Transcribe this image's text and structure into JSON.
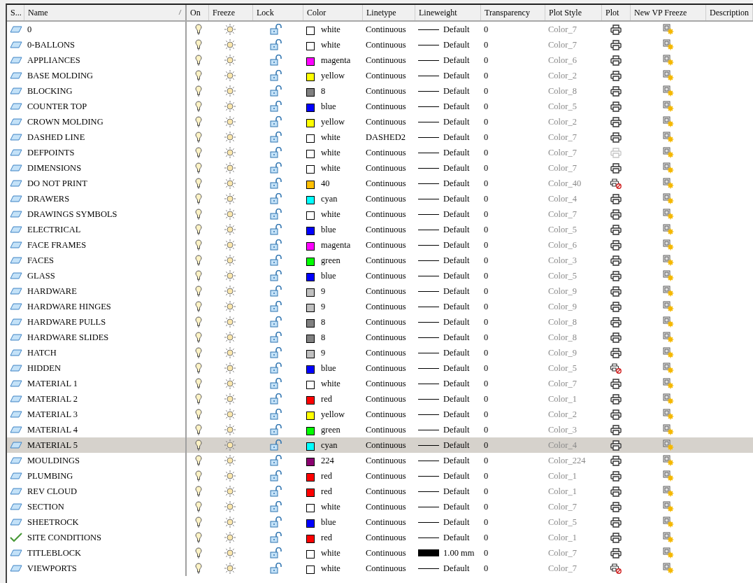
{
  "columns": [
    {
      "label": "S..."
    },
    {
      "label": "Name",
      "sorted": true
    },
    {
      "label": "On"
    },
    {
      "label": "Freeze"
    },
    {
      "label": "Lock"
    },
    {
      "label": "Color"
    },
    {
      "label": "Linetype"
    },
    {
      "label": "Lineweight"
    },
    {
      "label": "Transparency"
    },
    {
      "label": "Plot Style"
    },
    {
      "label": "Plot"
    },
    {
      "label": "New VP Freeze"
    },
    {
      "label": "Description"
    }
  ],
  "rows": [
    {
      "current": false,
      "name": "0",
      "on": true,
      "frozen": false,
      "locked": false,
      "color": "#ffffff",
      "color_name": "white",
      "linetype": "Continuous",
      "thick_line": false,
      "lineweight": "Default",
      "transparency": "0",
      "plot_style": "Color_7",
      "plot": true,
      "plot_dimmed": false,
      "selected": false
    },
    {
      "current": false,
      "name": "0-BALLONS",
      "on": true,
      "frozen": false,
      "locked": false,
      "color": "#ffffff",
      "color_name": "white",
      "linetype": "Continuous",
      "thick_line": false,
      "lineweight": "Default",
      "transparency": "0",
      "plot_style": "Color_7",
      "plot": true,
      "plot_dimmed": false,
      "selected": false
    },
    {
      "current": false,
      "name": "APPLIANCES",
      "on": true,
      "frozen": false,
      "locked": false,
      "color": "#ff00ff",
      "color_name": "magenta",
      "linetype": "Continuous",
      "thick_line": false,
      "lineweight": "Default",
      "transparency": "0",
      "plot_style": "Color_6",
      "plot": true,
      "plot_dimmed": false,
      "selected": false
    },
    {
      "current": false,
      "name": "BASE MOLDING",
      "on": true,
      "frozen": false,
      "locked": false,
      "color": "#ffff00",
      "color_name": "yellow",
      "linetype": "Continuous",
      "thick_line": false,
      "lineweight": "Default",
      "transparency": "0",
      "plot_style": "Color_2",
      "plot": true,
      "plot_dimmed": false,
      "selected": false
    },
    {
      "current": false,
      "name": "BLOCKING",
      "on": true,
      "frozen": false,
      "locked": false,
      "color": "#808080",
      "color_name": "8",
      "linetype": "Continuous",
      "thick_line": false,
      "lineweight": "Default",
      "transparency": "0",
      "plot_style": "Color_8",
      "plot": true,
      "plot_dimmed": false,
      "selected": false
    },
    {
      "current": false,
      "name": "COUNTER TOP",
      "on": true,
      "frozen": false,
      "locked": false,
      "color": "#0000ff",
      "color_name": "blue",
      "linetype": "Continuous",
      "thick_line": false,
      "lineweight": "Default",
      "transparency": "0",
      "plot_style": "Color_5",
      "plot": true,
      "plot_dimmed": false,
      "selected": false
    },
    {
      "current": false,
      "name": "CROWN MOLDING",
      "on": true,
      "frozen": false,
      "locked": false,
      "color": "#ffff00",
      "color_name": "yellow",
      "linetype": "Continuous",
      "thick_line": false,
      "lineweight": "Default",
      "transparency": "0",
      "plot_style": "Color_2",
      "plot": true,
      "plot_dimmed": false,
      "selected": false
    },
    {
      "current": false,
      "name": "DASHED LINE",
      "on": true,
      "frozen": false,
      "locked": false,
      "color": "#ffffff",
      "color_name": "white",
      "linetype": "DASHED2",
      "thick_line": false,
      "lineweight": "Default",
      "transparency": "0",
      "plot_style": "Color_7",
      "plot": true,
      "plot_dimmed": false,
      "selected": false
    },
    {
      "current": false,
      "name": "DEFPOINTS",
      "on": true,
      "frozen": false,
      "locked": false,
      "color": "#ffffff",
      "color_name": "white",
      "linetype": "Continuous",
      "thick_line": false,
      "lineweight": "Default",
      "transparency": "0",
      "plot_style": "Color_7",
      "plot": true,
      "plot_dimmed": true,
      "selected": false
    },
    {
      "current": false,
      "name": "DIMENSIONS",
      "on": true,
      "frozen": false,
      "locked": false,
      "color": "#ffffff",
      "color_name": "white",
      "linetype": "Continuous",
      "thick_line": false,
      "lineweight": "Default",
      "transparency": "0",
      "plot_style": "Color_7",
      "plot": true,
      "plot_dimmed": false,
      "selected": false
    },
    {
      "current": false,
      "name": "DO NOT PRINT",
      "on": true,
      "frozen": false,
      "locked": false,
      "color": "#ffbf00",
      "color_name": "40",
      "linetype": "Continuous",
      "thick_line": false,
      "lineweight": "Default",
      "transparency": "0",
      "plot_style": "Color_40",
      "plot": false,
      "plot_dimmed": false,
      "selected": false
    },
    {
      "current": false,
      "name": "DRAWERS",
      "on": true,
      "frozen": false,
      "locked": false,
      "color": "#00ffff",
      "color_name": "cyan",
      "linetype": "Continuous",
      "thick_line": false,
      "lineweight": "Default",
      "transparency": "0",
      "plot_style": "Color_4",
      "plot": true,
      "plot_dimmed": false,
      "selected": false
    },
    {
      "current": false,
      "name": "DRAWINGS SYMBOLS",
      "on": true,
      "frozen": false,
      "locked": false,
      "color": "#ffffff",
      "color_name": "white",
      "linetype": "Continuous",
      "thick_line": false,
      "lineweight": "Default",
      "transparency": "0",
      "plot_style": "Color_7",
      "plot": true,
      "plot_dimmed": false,
      "selected": false
    },
    {
      "current": false,
      "name": "ELECTRICAL",
      "on": true,
      "frozen": false,
      "locked": false,
      "color": "#0000ff",
      "color_name": "blue",
      "linetype": "Continuous",
      "thick_line": false,
      "lineweight": "Default",
      "transparency": "0",
      "plot_style": "Color_5",
      "plot": true,
      "plot_dimmed": false,
      "selected": false
    },
    {
      "current": false,
      "name": "FACE FRAMES",
      "on": true,
      "frozen": false,
      "locked": false,
      "color": "#ff00ff",
      "color_name": "magenta",
      "linetype": "Continuous",
      "thick_line": false,
      "lineweight": "Default",
      "transparency": "0",
      "plot_style": "Color_6",
      "plot": true,
      "plot_dimmed": false,
      "selected": false
    },
    {
      "current": false,
      "name": "FACES",
      "on": true,
      "frozen": false,
      "locked": false,
      "color": "#00ff00",
      "color_name": "green",
      "linetype": "Continuous",
      "thick_line": false,
      "lineweight": "Default",
      "transparency": "0",
      "plot_style": "Color_3",
      "plot": true,
      "plot_dimmed": false,
      "selected": false
    },
    {
      "current": false,
      "name": "GLASS",
      "on": true,
      "frozen": false,
      "locked": false,
      "color": "#0000ff",
      "color_name": "blue",
      "linetype": "Continuous",
      "thick_line": false,
      "lineweight": "Default",
      "transparency": "0",
      "plot_style": "Color_5",
      "plot": true,
      "plot_dimmed": false,
      "selected": false
    },
    {
      "current": false,
      "name": "HARDWARE",
      "on": true,
      "frozen": false,
      "locked": false,
      "color": "#c0c0c0",
      "color_name": "9",
      "linetype": "Continuous",
      "thick_line": false,
      "lineweight": "Default",
      "transparency": "0",
      "plot_style": "Color_9",
      "plot": true,
      "plot_dimmed": false,
      "selected": false
    },
    {
      "current": false,
      "name": "HARDWARE HINGES",
      "on": true,
      "frozen": false,
      "locked": false,
      "color": "#c0c0c0",
      "color_name": "9",
      "linetype": "Continuous",
      "thick_line": false,
      "lineweight": "Default",
      "transparency": "0",
      "plot_style": "Color_9",
      "plot": true,
      "plot_dimmed": false,
      "selected": false
    },
    {
      "current": false,
      "name": "HARDWARE PULLS",
      "on": true,
      "frozen": false,
      "locked": false,
      "color": "#808080",
      "color_name": "8",
      "linetype": "Continuous",
      "thick_line": false,
      "lineweight": "Default",
      "transparency": "0",
      "plot_style": "Color_8",
      "plot": true,
      "plot_dimmed": false,
      "selected": false
    },
    {
      "current": false,
      "name": "HARDWARE SLIDES",
      "on": true,
      "frozen": false,
      "locked": false,
      "color": "#808080",
      "color_name": "8",
      "linetype": "Continuous",
      "thick_line": false,
      "lineweight": "Default",
      "transparency": "0",
      "plot_style": "Color_8",
      "plot": true,
      "plot_dimmed": false,
      "selected": false
    },
    {
      "current": false,
      "name": "HATCH",
      "on": true,
      "frozen": false,
      "locked": false,
      "color": "#c0c0c0",
      "color_name": "9",
      "linetype": "Continuous",
      "thick_line": false,
      "lineweight": "Default",
      "transparency": "0",
      "plot_style": "Color_9",
      "plot": true,
      "plot_dimmed": false,
      "selected": false
    },
    {
      "current": false,
      "name": "HIDDEN",
      "on": true,
      "frozen": false,
      "locked": false,
      "color": "#0000ff",
      "color_name": "blue",
      "linetype": "Continuous",
      "thick_line": false,
      "lineweight": "Default",
      "transparency": "0",
      "plot_style": "Color_5",
      "plot": false,
      "plot_dimmed": false,
      "selected": false
    },
    {
      "current": false,
      "name": "MATERIAL 1",
      "on": true,
      "frozen": false,
      "locked": false,
      "color": "#ffffff",
      "color_name": "white",
      "linetype": "Continuous",
      "thick_line": false,
      "lineweight": "Default",
      "transparency": "0",
      "plot_style": "Color_7",
      "plot": true,
      "plot_dimmed": false,
      "selected": false
    },
    {
      "current": false,
      "name": "MATERIAL 2",
      "on": true,
      "frozen": false,
      "locked": false,
      "color": "#ff0000",
      "color_name": "red",
      "linetype": "Continuous",
      "thick_line": false,
      "lineweight": "Default",
      "transparency": "0",
      "plot_style": "Color_1",
      "plot": true,
      "plot_dimmed": false,
      "selected": false
    },
    {
      "current": false,
      "name": "MATERIAL 3",
      "on": true,
      "frozen": false,
      "locked": false,
      "color": "#ffff00",
      "color_name": "yellow",
      "linetype": "Continuous",
      "thick_line": false,
      "lineweight": "Default",
      "transparency": "0",
      "plot_style": "Color_2",
      "plot": true,
      "plot_dimmed": false,
      "selected": false
    },
    {
      "current": false,
      "name": "MATERIAL 4",
      "on": true,
      "frozen": false,
      "locked": false,
      "color": "#00ff00",
      "color_name": "green",
      "linetype": "Continuous",
      "thick_line": false,
      "lineweight": "Default",
      "transparency": "0",
      "plot_style": "Color_3",
      "plot": true,
      "plot_dimmed": false,
      "selected": false
    },
    {
      "current": false,
      "name": "MATERIAL 5",
      "on": true,
      "frozen": false,
      "locked": false,
      "color": "#00ffff",
      "color_name": "cyan",
      "linetype": "Continuous",
      "thick_line": false,
      "lineweight": "Default",
      "transparency": "0",
      "plot_style": "Color_4",
      "plot": true,
      "plot_dimmed": false,
      "selected": true
    },
    {
      "current": false,
      "name": "MOULDINGS",
      "on": true,
      "frozen": false,
      "locked": false,
      "color": "#8b0070",
      "color_name": "224",
      "linetype": "Continuous",
      "thick_line": false,
      "lineweight": "Default",
      "transparency": "0",
      "plot_style": "Color_224",
      "plot": true,
      "plot_dimmed": false,
      "selected": false
    },
    {
      "current": false,
      "name": "PLUMBING",
      "on": true,
      "frozen": false,
      "locked": false,
      "color": "#ff0000",
      "color_name": "red",
      "linetype": "Continuous",
      "thick_line": false,
      "lineweight": "Default",
      "transparency": "0",
      "plot_style": "Color_1",
      "plot": true,
      "plot_dimmed": false,
      "selected": false
    },
    {
      "current": false,
      "name": "REV CLOUD",
      "on": true,
      "frozen": false,
      "locked": false,
      "color": "#ff0000",
      "color_name": "red",
      "linetype": "Continuous",
      "thick_line": false,
      "lineweight": "Default",
      "transparency": "0",
      "plot_style": "Color_1",
      "plot": true,
      "plot_dimmed": false,
      "selected": false
    },
    {
      "current": false,
      "name": "SECTION",
      "on": true,
      "frozen": false,
      "locked": false,
      "color": "#ffffff",
      "color_name": "white",
      "linetype": "Continuous",
      "thick_line": false,
      "lineweight": "Default",
      "transparency": "0",
      "plot_style": "Color_7",
      "plot": true,
      "plot_dimmed": false,
      "selected": false
    },
    {
      "current": false,
      "name": "SHEETROCK",
      "on": true,
      "frozen": false,
      "locked": false,
      "color": "#0000ff",
      "color_name": "blue",
      "linetype": "Continuous",
      "thick_line": false,
      "lineweight": "Default",
      "transparency": "0",
      "plot_style": "Color_5",
      "plot": true,
      "plot_dimmed": false,
      "selected": false
    },
    {
      "current": true,
      "name": "SITE CONDITIONS",
      "on": true,
      "frozen": false,
      "locked": false,
      "color": "#ff0000",
      "color_name": "red",
      "linetype": "Continuous",
      "thick_line": false,
      "lineweight": "Default",
      "transparency": "0",
      "plot_style": "Color_1",
      "plot": true,
      "plot_dimmed": false,
      "selected": false
    },
    {
      "current": false,
      "name": "TITLEBLOCK",
      "on": true,
      "frozen": false,
      "locked": false,
      "color": "#ffffff",
      "color_name": "white",
      "linetype": "Continuous",
      "thick_line": true,
      "lineweight": "1.00 mm",
      "transparency": "0",
      "plot_style": "Color_7",
      "plot": true,
      "plot_dimmed": false,
      "selected": false
    },
    {
      "current": false,
      "name": "VIEWPORTS",
      "on": true,
      "frozen": false,
      "locked": false,
      "color": "#ffffff",
      "color_name": "white",
      "linetype": "Continuous",
      "thick_line": false,
      "lineweight": "Default",
      "transparency": "0",
      "plot_style": "Color_7",
      "plot": false,
      "plot_dimmed": false,
      "selected": false
    }
  ]
}
